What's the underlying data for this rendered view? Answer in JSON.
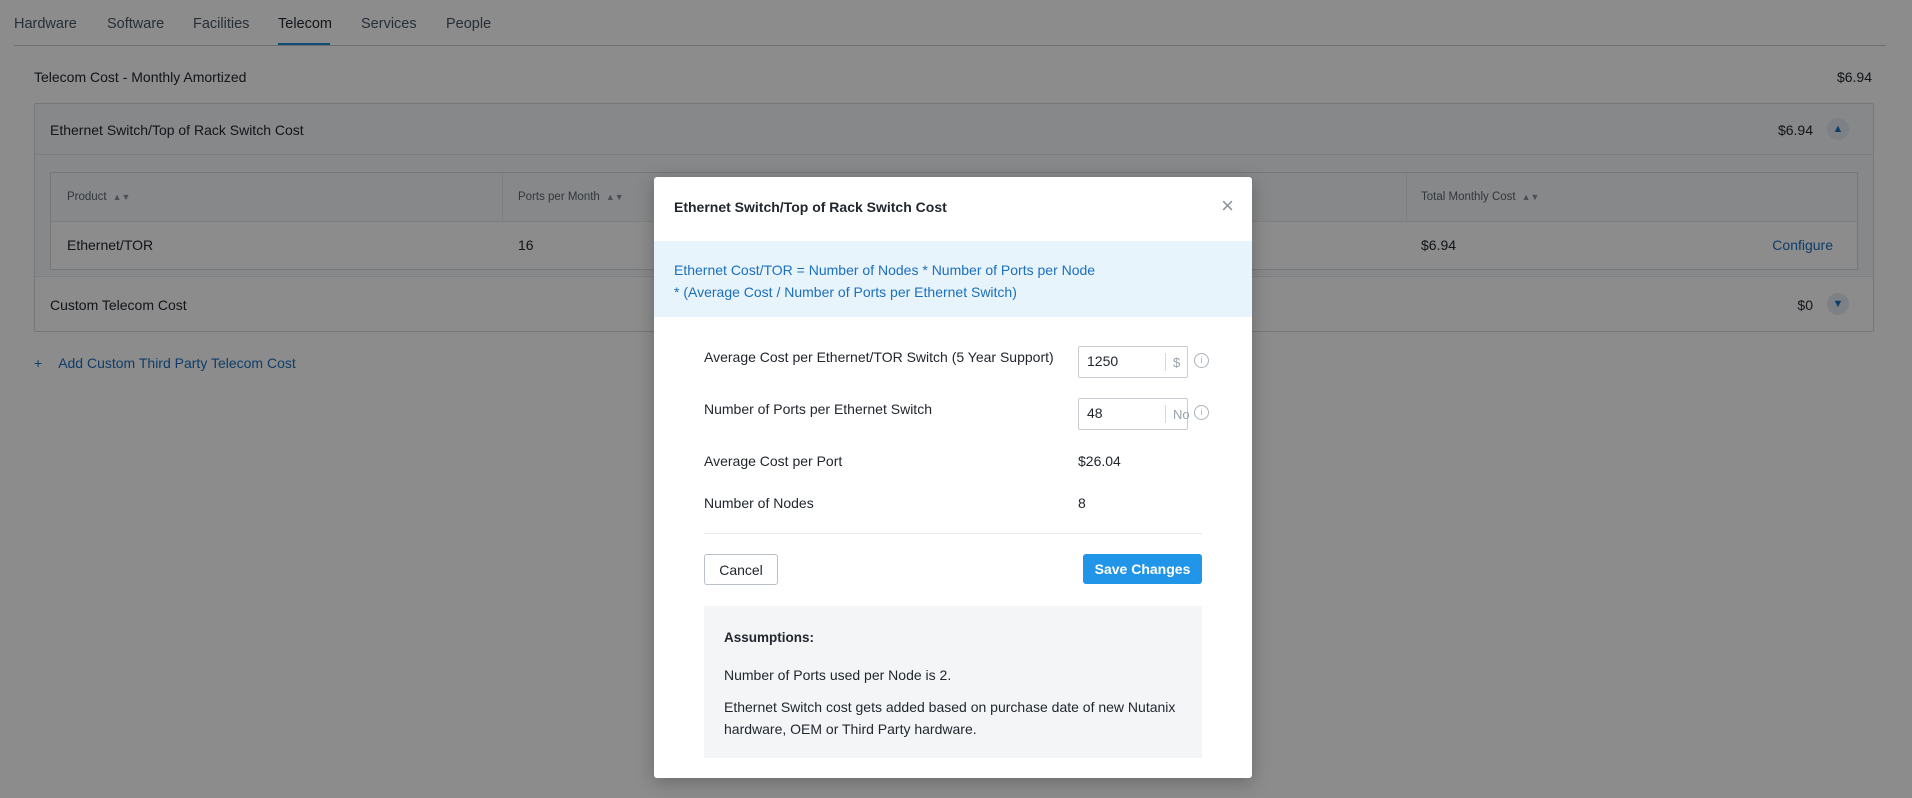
{
  "tabs": [
    {
      "label": "Hardware"
    },
    {
      "label": "Software"
    },
    {
      "label": "Facilities"
    },
    {
      "label": "Telecom",
      "active": true
    },
    {
      "label": "Services"
    },
    {
      "label": "People"
    }
  ],
  "summary": {
    "label": "Telecom Cost - Monthly Amortized",
    "value": "$6.94"
  },
  "ethernet_section": {
    "title": "Ethernet Switch/Top of Rack Switch Cost",
    "amount": "$6.94",
    "expanded": true,
    "table": {
      "headers": {
        "product": "Product",
        "ports": "Ports per Month",
        "total": "Total Monthly Cost"
      },
      "rows": [
        {
          "product": "Ethernet/TOR",
          "ports": "16",
          "total": "$6.94",
          "action": "Configure"
        }
      ]
    }
  },
  "custom_section": {
    "title": "Custom Telecom Cost",
    "amount": "$0",
    "expanded": false
  },
  "add_link": {
    "plus": "+",
    "label": "Add Custom Third Party Telecom Cost"
  },
  "modal": {
    "title": "Ethernet Switch/Top of Rack Switch Cost",
    "close": "×",
    "formula_line1": "Ethernet Cost/TOR = Number of Nodes * Number of Ports per Node",
    "formula_line2": "* (Average Cost / Number of Ports per Ethernet Switch)",
    "fields": {
      "avg_cost": {
        "label": "Average Cost per Ethernet/TOR Switch (5 Year Support)",
        "value": "1250",
        "unit": "$"
      },
      "ports_per_switch": {
        "label": "Number of Ports per Ethernet Switch",
        "value": "48",
        "unit": "No"
      },
      "avg_cost_per_port": {
        "label": "Average Cost per Port",
        "value": "$26.04"
      },
      "nodes": {
        "label": "Number of Nodes",
        "value": "8"
      }
    },
    "cancel_label": "Cancel",
    "save_label": "Save Changes",
    "assumptions": {
      "title": "Assumptions:",
      "line1": "Number of Ports used per Node is 2.",
      "line2": "Ethernet Switch cost gets added based on purchase date of new Nutanix hardware, OEM or Third Party hardware."
    }
  },
  "colors": {
    "accent": "#1b6fbf",
    "primary_button": "#2196e8",
    "formula_bg": "#e8f4fb"
  }
}
